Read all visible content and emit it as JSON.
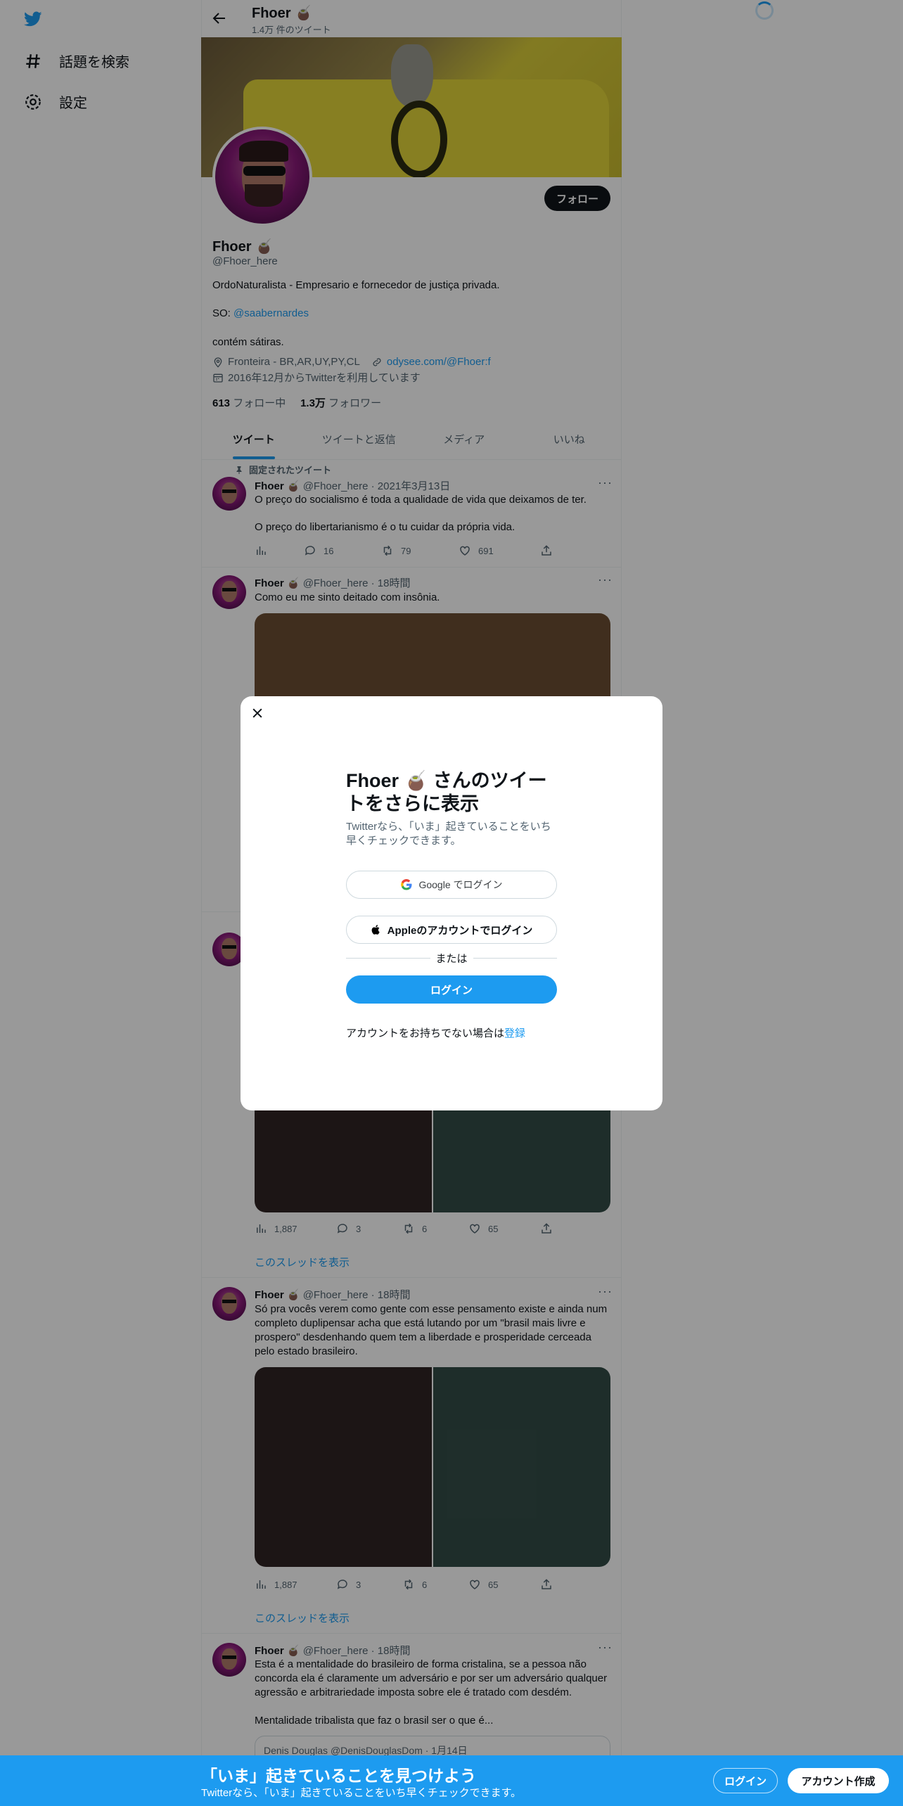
{
  "nav": {
    "logo": "twitter-bird-icon",
    "items": [
      {
        "label": "話題を検索",
        "icon": "hashtag-icon"
      },
      {
        "label": "設定",
        "icon": "gear-icon"
      }
    ]
  },
  "header": {
    "name": "Fhoer 🧉",
    "tweet_count": "1.4万 件のツイート"
  },
  "profile": {
    "follow_label": "フォロー",
    "name": "Fhoer 🧉",
    "handle": "@Fhoer_here",
    "bio_line1": "OrdoNaturalista - Empresario e fornecedor de justiça privada.",
    "bio_so_prefix": "SO: ",
    "bio_so_link": "@saabernardes",
    "bio_line3": "contém sátiras.",
    "location": "Fronteira - BR,AR,UY,PY,CL",
    "website": "odysee.com/@Fhoer:f",
    "joined": "2016年12月からTwitterを利用しています",
    "following_count": "613",
    "following_label": "フォロー中",
    "followers_count": "1.3万",
    "followers_label": "フォロワー"
  },
  "tabs": [
    "ツイート",
    "ツイートと返信",
    "メディア",
    "いいね"
  ],
  "tweets": [
    {
      "pinned_label": "固定されたツイート",
      "author": "Fhoer 🧉",
      "handle_time": "@Fhoer_here · 2021年3月13日",
      "text1": "O preço do socialismo é toda a qualidade de vida que deixamos de ter.",
      "text2": "O preço do libertarianismo é o tu cuidar da própria vida.",
      "replies": "16",
      "retweets": "79",
      "likes": "691"
    },
    {
      "author": "Fhoer 🧉",
      "handle_time": "@Fhoer_here · 18時間",
      "text1": "Como eu me sinto deitado com insônia."
    },
    {
      "views": "1,887",
      "replies": "3",
      "retweets": "6",
      "likes": "65",
      "thread_link": "このスレッドを表示"
    },
    {
      "author": "Fhoer 🧉",
      "handle_time": "@Fhoer_here · 18時間",
      "text1": "Só pra vocês verem como gente com esse pensamento existe e ainda num completo duplipensar acha que está lutando por um \"brasil mais livre e prospero\" desdenhando quem tem a liberdade e prosperidade cerceada pelo estado brasileiro.",
      "views": "1,887",
      "replies": "3",
      "retweets": "6",
      "likes": "65",
      "thread_link": "このスレッドを表示"
    },
    {
      "author": "Fhoer 🧉",
      "handle_time": "@Fhoer_here · 18時間",
      "text1": "Esta é a mentalidade do brasileiro de forma cristalina, se a pessoa não concorda ela é claramente um adversário e por ser um adversário qualquer agressão e arbitrariedade imposta sobre ele é tratado com desdém.",
      "text2": "Mentalidade tribalista que faz o brasil ser o que é...",
      "quoted": "Denis Douglas @DenisDouglasDom · 1月14日"
    }
  ],
  "modal": {
    "title": "Fhoer 🧉 さんのツイートをさらに表示",
    "subtitle": "Twitterなら、「いま」起きていることをいち早くチェックできます。",
    "google_label": "Google でログイン",
    "apple_label": "Appleのアカウントでログイン",
    "or_label": "または",
    "login_label": "ログイン",
    "signup_prompt": "アカウントをお持ちでない場合は",
    "signup_link": "登録"
  },
  "bottom_bar": {
    "title": "「いま」起きていることを見つけよう",
    "subtitle": "Twitterなら、「いま」起きていることをいち早くチェックできます。",
    "login_label": "ログイン",
    "signup_label": "アカウント作成"
  },
  "colors": {
    "accent": "#1d9bf0",
    "text": "#0f1419",
    "muted": "#536471"
  }
}
